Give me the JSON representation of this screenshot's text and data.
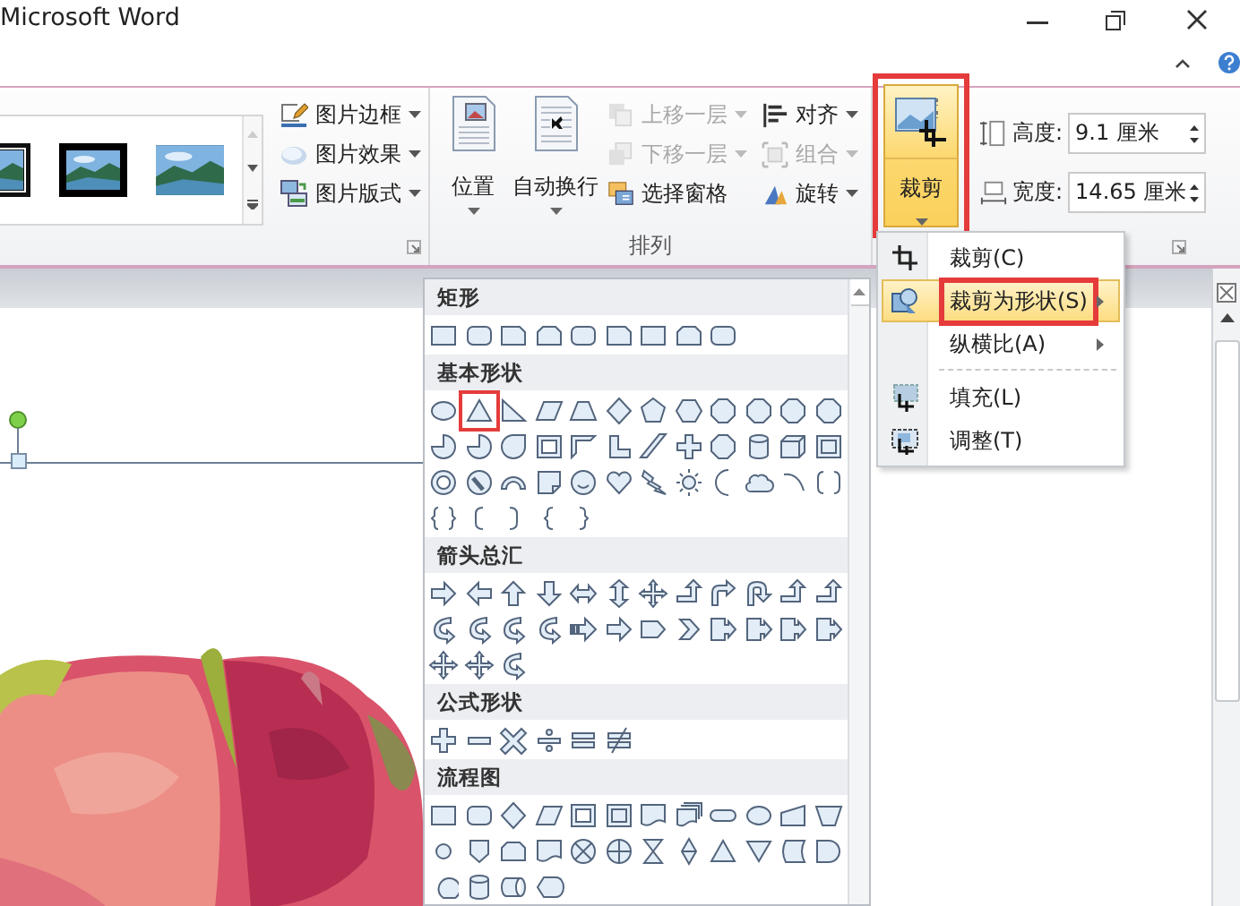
{
  "window": {
    "title": "Microsoft Word"
  },
  "ribbon": {
    "picture_buttons": [
      {
        "label": "图片边框",
        "dropdown": true
      },
      {
        "label": "图片效果",
        "dropdown": true
      },
      {
        "label": "图片版式",
        "dropdown": true
      }
    ],
    "arrange": {
      "label": "排列",
      "large_buttons": [
        {
          "label": "位置"
        },
        {
          "label": "自动换行"
        }
      ],
      "small_buttons": [
        {
          "label": "上移一层",
          "disabled": true,
          "dropdown": true
        },
        {
          "label": "下移一层",
          "disabled": true,
          "dropdown": true
        },
        {
          "label": "选择窗格",
          "disabled": false,
          "dropdown": false
        },
        {
          "label": "对齐",
          "disabled": false,
          "dropdown": true
        },
        {
          "label": "组合",
          "disabled": true,
          "dropdown": true
        },
        {
          "label": "旋转",
          "disabled": false,
          "dropdown": true
        }
      ]
    },
    "crop_button": {
      "label": "裁剪",
      "pressed": true,
      "highlighted": true
    },
    "size_fields": [
      {
        "label": "高度:",
        "value": "9.1 厘米"
      },
      {
        "label": "宽度:",
        "value": "14.65 厘米"
      }
    ]
  },
  "crop_menu": [
    {
      "label": "裁剪(C)",
      "selected": false,
      "submenu": false,
      "highlighted": false
    },
    {
      "label": "裁剪为形状(S)",
      "selected": true,
      "submenu": true,
      "highlighted": true
    },
    {
      "label": "纵横比(A)",
      "selected": false,
      "submenu": true,
      "highlighted": false
    },
    {
      "label": "填充(L)",
      "selected": false,
      "submenu": false,
      "highlighted": false
    },
    {
      "label": "调整(T)",
      "selected": false,
      "submenu": false,
      "highlighted": false
    }
  ],
  "shape_gallery": {
    "sections": [
      {
        "title": "矩形",
        "highlighted": false
      },
      {
        "title": "基本形状",
        "highlighted": true
      },
      {
        "title": "箭头总汇",
        "highlighted": false
      },
      {
        "title": "公式形状",
        "highlighted": false
      },
      {
        "title": "流程图",
        "highlighted": false
      }
    ]
  }
}
